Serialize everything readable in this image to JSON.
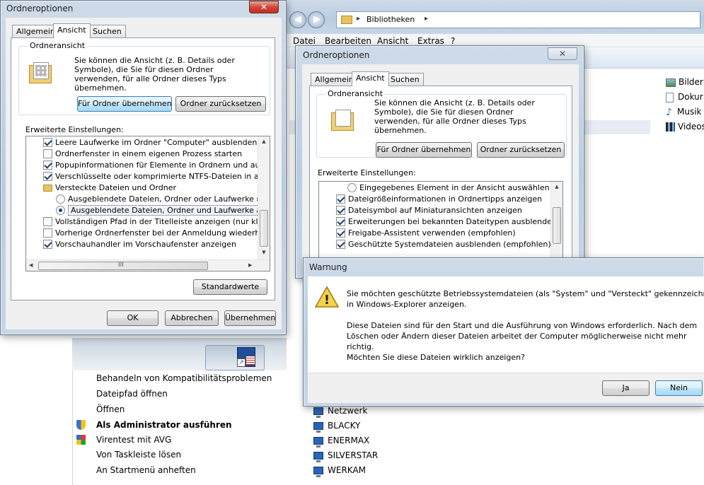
{
  "explorer": {
    "breadcrumb_root": "Bibliotheken",
    "breadcrumb_sep": "▸",
    "menu": [
      "Datei",
      "Bearbeiten",
      "Ansicht",
      "Extras",
      "?"
    ],
    "libraries": [
      "Bilder",
      "Dokur",
      "Musik",
      "Videos"
    ],
    "network_label": "Netzwerk",
    "network_items": [
      "BLACKY",
      "ENERMAX",
      "SILVERSTAR",
      "WERKAM"
    ]
  },
  "dialog1": {
    "title": "Ordneroptionen",
    "tabs": [
      "Allgemein",
      "Ansicht",
      "Suchen"
    ],
    "group_label": "Ordneransicht",
    "group_text": "Sie können die Ansicht (z. B. Details oder Symbole), die Sie für diesen Ordner verwenden, für alle Ordner dieses Typs übernehmen.",
    "apply_button": "Für Ordner übernehmen",
    "reset_button": "Ordner zurücksetzen",
    "advanced_label": "Erweiterte Einstellungen:",
    "items": [
      {
        "type": "checkbox",
        "checked": true,
        "label": "Leere Laufwerke im Ordner \"Computer\" ausblenden"
      },
      {
        "type": "checkbox",
        "checked": false,
        "label": "Ordnerfenster in einem eigenen Prozess starten"
      },
      {
        "type": "checkbox",
        "checked": true,
        "label": "Popupinformationen für Elemente in Ordnern und auf dem D"
      },
      {
        "type": "checkbox",
        "checked": true,
        "label": "Verschlüsselte oder komprimierte NTFS-Dateien in anderer"
      },
      {
        "type": "folder",
        "label": "Versteckte Dateien und Ordner"
      },
      {
        "type": "radio",
        "checked": false,
        "label": "Ausgeblendete Dateien, Ordner oder Laufwerke nicht a"
      },
      {
        "type": "radio",
        "checked": true,
        "label": "Ausgeblendete Dateien, Ordner und Laufwerke anzeigen"
      },
      {
        "type": "checkbox",
        "checked": false,
        "label": "Vollständigen Pfad in der Titelleiste anzeigen (nur klassisch"
      },
      {
        "type": "checkbox",
        "checked": false,
        "label": "Vorherige Ordnerfenster bei der Anmeldung wiederherstellen"
      },
      {
        "type": "checkbox",
        "checked": true,
        "label": "Vorschauhandler im Vorschaufenster anzeigen"
      }
    ],
    "hscroll_grip": "III",
    "defaults_button": "Standardwerte",
    "ok": "OK",
    "cancel": "Abbrechen",
    "apply": "Übernehmen"
  },
  "dialog2": {
    "title": "Ordneroptionen",
    "tabs": [
      "Allgemein",
      "Ansicht",
      "Suchen"
    ],
    "group_label": "Ordneransicht",
    "group_text": "Sie können die Ansicht (z. B. Details oder Symbole), die Sie für diesen Ordner verwenden, für alle Ordner dieses Typs übernehmen.",
    "apply_button": "Für Ordner übernehmen",
    "reset_button": "Ordner zurücksetzen",
    "advanced_label": "Erweiterte Einstellungen:",
    "items": [
      {
        "type": "radio",
        "checked": false,
        "label": "Eingegebenes Element in der Ansicht auswählen"
      },
      {
        "type": "checkbox",
        "checked": true,
        "label": "Dateigrößeinformationen in Ordnertipps anzeigen"
      },
      {
        "type": "checkbox",
        "checked": true,
        "label": "Dateisymbol auf Miniaturansichten anzeigen"
      },
      {
        "type": "checkbox",
        "checked": true,
        "label": "Erweiterungen bei bekannten Dateitypen ausblenden"
      },
      {
        "type": "checkbox",
        "checked": true,
        "label": "Freigabe-Assistent verwenden (empfohlen)"
      },
      {
        "type": "checkbox",
        "checked": true,
        "label": "Geschützte Systemdateien ausblenden (empfohlen)"
      }
    ]
  },
  "warning": {
    "title": "Warnung",
    "line1": "Sie möchten geschützte Betriebssystemdateien (als \"System\" und \"Versteckt\" gekennzeichnet)",
    "line2": "in Windows-Explorer anzeigen.",
    "para2_line1": "Diese Dateien sind für den Start und die Ausführung von Windows erforderlich. Nach dem",
    "para2_line2": "Löschen oder Ändern dieser Dateien arbeitet der Computer möglicherweise nicht mehr",
    "para2_line3": "richtig.",
    "question": "Möchten Sie diese Dateien wirklich anzeigen?",
    "yes": "Ja",
    "no": "Nein"
  },
  "context_menu": {
    "items": [
      {
        "label": "Behandeln von Kompatibilitätsproblemen",
        "icon": "",
        "bold": false
      },
      {
        "label": "Dateipfad öffnen",
        "icon": "",
        "bold": false
      },
      {
        "label": "Öffnen",
        "icon": "",
        "bold": false
      },
      {
        "label": "Als Administrator ausführen",
        "icon": "shield-icon",
        "bold": true
      },
      {
        "label": "Virentest mit AVG",
        "icon": "avg-icon",
        "bold": false
      },
      {
        "label": "Von Taskleiste lösen",
        "icon": "",
        "bold": false
      },
      {
        "label": "An Startmenü anheften",
        "icon": "",
        "bold": false
      }
    ]
  },
  "colors": {
    "accent": "#3c7fb1",
    "title_bar": "#c3d4e7",
    "close_red": "#c7392a"
  }
}
